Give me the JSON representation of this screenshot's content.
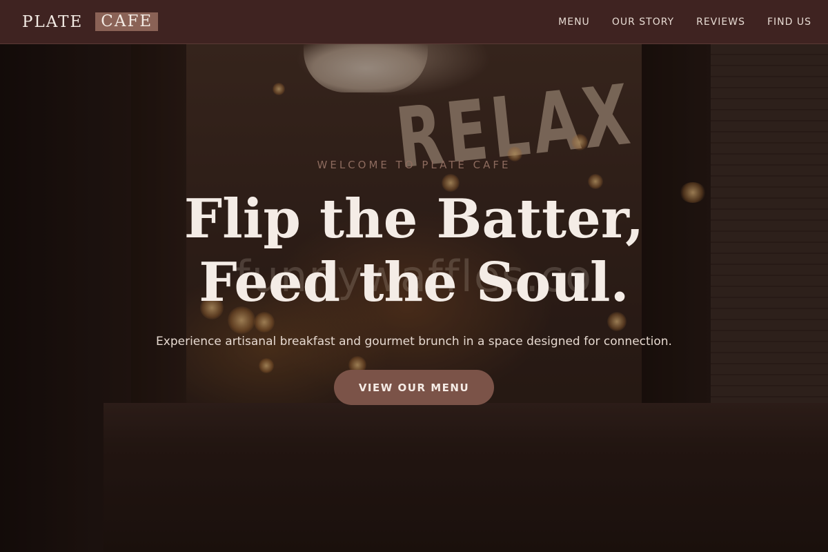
{
  "header": {
    "logo": {
      "part_a": "PLATE",
      "part_b": "CAFE"
    },
    "nav": [
      {
        "label": "MENU"
      },
      {
        "label": "OUR STORY"
      },
      {
        "label": "REVIEWS"
      },
      {
        "label": "FIND US"
      }
    ]
  },
  "hero": {
    "eyebrow": "WELCOME TO PLATE CAFE",
    "headline_line1": "Flip the Batter,",
    "headline_line2": "Feed the Soul.",
    "ghost_text": "funnywaffles.co",
    "subtitle": "Experience artisanal breakfast and gourmet brunch in a space designed for connection.",
    "cta_label": "VIEW OUR MENU",
    "background_sign": "RELAX"
  },
  "colors": {
    "header_bg": "#3f2321",
    "accent": "#7b5348",
    "logo_highlight": "#8a6256",
    "text_light": "#f4ece6",
    "eyebrow": "#8c6a5d"
  }
}
